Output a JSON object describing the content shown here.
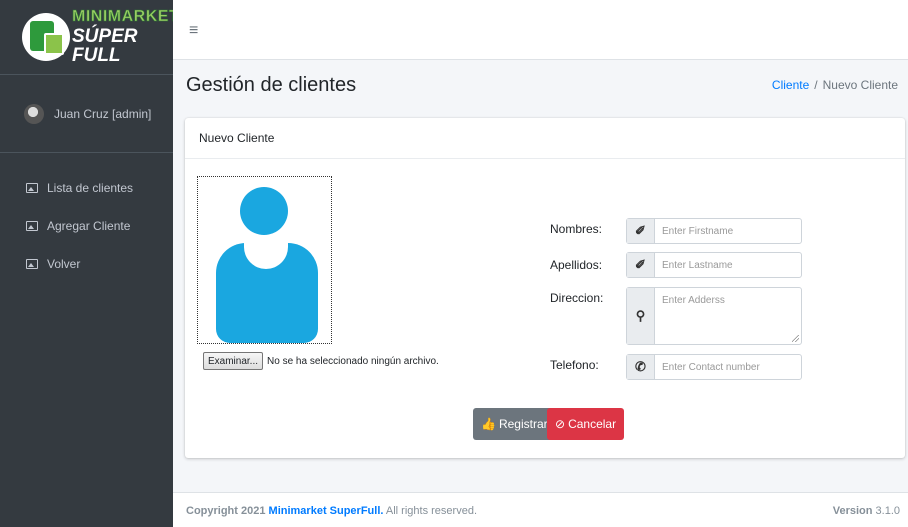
{
  "brand": {
    "line1": "MINIMARKET",
    "line2": "SÚPER FULL"
  },
  "user": {
    "name": "Juan Cruz [admin]"
  },
  "sidebar": {
    "items": [
      {
        "label": "Lista de clientes",
        "icon": "image-icon"
      },
      {
        "label": "Agregar Cliente",
        "icon": "image-icon"
      },
      {
        "label": "Volver",
        "icon": "image-icon"
      }
    ]
  },
  "topbar": {
    "menu_icon": "≡"
  },
  "header": {
    "title": "Gestión de clientes",
    "breadcrumb": {
      "link": "Cliente",
      "separator": "/",
      "current": "Nuevo Cliente"
    }
  },
  "card": {
    "title": "Nuevo Cliente",
    "file": {
      "button": "Examinar...",
      "status": "No se ha seleccionado ningún archivo."
    },
    "fields": {
      "nombres": {
        "label": "Nombres:",
        "placeholder": "Enter Firstname",
        "icon": "pencil-icon"
      },
      "apellidos": {
        "label": "Apellidos:",
        "placeholder": "Enter Lastname",
        "icon": "pencil-icon"
      },
      "direccion": {
        "label": "Direccion:",
        "placeholder": "Enter Adderss",
        "icon": "map-marker-icon"
      },
      "telefono": {
        "label": "Telefono:",
        "placeholder": "Enter Contact number",
        "icon": "phone-icon"
      }
    },
    "buttons": {
      "register": "Registrart",
      "cancel": "Cancelar"
    },
    "colors": {
      "register": "#6c757d",
      "cancel": "#dc3545",
      "avatar": "#1aa7e0"
    }
  },
  "footer": {
    "copyright": "Copyright 2021",
    "brand": "Minimarket SuperFull.",
    "rights": "All rights reserved.",
    "version_label": "Version",
    "version": "3.1.0"
  }
}
